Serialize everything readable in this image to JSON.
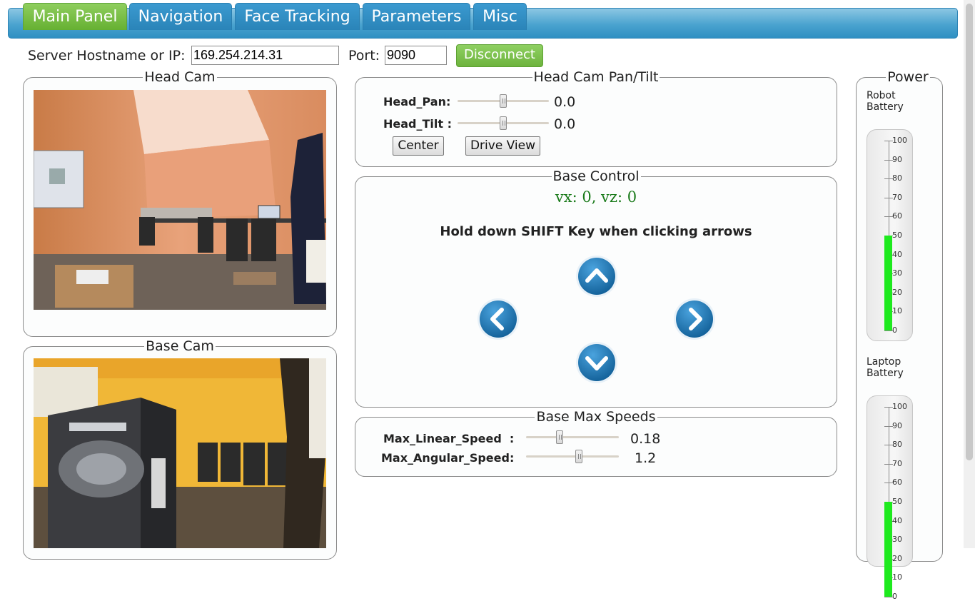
{
  "tabs": [
    {
      "label": "Main Panel",
      "active": true
    },
    {
      "label": "Navigation",
      "active": false
    },
    {
      "label": "Face Tracking",
      "active": false
    },
    {
      "label": "Parameters",
      "active": false
    },
    {
      "label": "Misc",
      "active": false
    }
  ],
  "connection": {
    "host_label": "Server Hostname or IP:",
    "host_value": "169.254.214.31",
    "port_label": "Port:",
    "port_value": "9090",
    "disconnect_label": "Disconnect"
  },
  "head_cam": {
    "title": "Head Cam"
  },
  "base_cam": {
    "title": "Base Cam"
  },
  "pan_tilt": {
    "title": "Head Cam Pan/Tilt",
    "pan_label": "Head_Pan:",
    "pan_value": "0.0",
    "tilt_label": "Head_Tilt :",
    "tilt_value": "0.0",
    "center_label": "Center",
    "drive_view_label": "Drive View"
  },
  "base_control": {
    "title": "Base Control",
    "velocity_text": "vx: 0, vz: 0",
    "instruction": "Hold down SHIFT Key when clicking arrows"
  },
  "max_speeds": {
    "title": "Base Max Speeds",
    "linear_label": "Max_Linear_Speed  :",
    "linear_value": "0.18",
    "angular_label": "Max_Angular_Speed:",
    "angular_value": "1.2"
  },
  "power": {
    "title": "Power",
    "robot_label_line1": "Robot",
    "robot_label_line2": "Battery",
    "robot_level": 50,
    "laptop_label_line1": "Laptop",
    "laptop_label_line2": "Battery",
    "laptop_level": 50,
    "gauge_ticks": [
      "100",
      "90",
      "80",
      "70",
      "60",
      "50",
      "40",
      "30",
      "20",
      "10",
      "0"
    ],
    "fill_color": "#1eea1e"
  },
  "colors": {
    "tab_active": "#6db33d",
    "tab_inactive": "#2f8fc2",
    "velocity_text": "#1a7a1a",
    "arrow_button": "#1b6fa8"
  }
}
